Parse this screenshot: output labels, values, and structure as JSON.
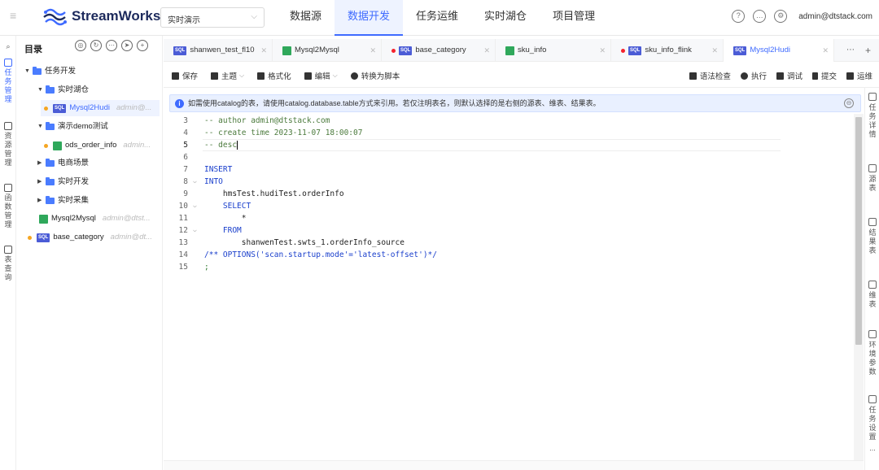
{
  "app": {
    "name": "StreamWorks",
    "project": "实时演示",
    "user": "admin@dtstack.com"
  },
  "nav": [
    "数据源",
    "数据开发",
    "任务运维",
    "实时湖仓",
    "项目管理"
  ],
  "nav_active": "数据开发",
  "left_rail": [
    "任务管理",
    "资源管理",
    "函数管理",
    "表查询"
  ],
  "sidebar": {
    "title": "目录",
    "tree": [
      {
        "label": "任务开发"
      },
      {
        "label": "实时湖仓"
      },
      {
        "label": "Mysql2Hudi",
        "owner": "admin@..."
      },
      {
        "label": "演示demo测试"
      },
      {
        "label": "ods_order_info",
        "owner": "admin..."
      },
      {
        "label": "电商场景"
      },
      {
        "label": "实时开发"
      },
      {
        "label": "实时采集"
      },
      {
        "label": "Mysql2Mysql",
        "owner": "admin@dtst..."
      },
      {
        "label": "base_category",
        "owner": "admin@dt..."
      }
    ]
  },
  "tabs": [
    {
      "label": "shanwen_test_fl10"
    },
    {
      "label": "Mysql2Mysql"
    },
    {
      "label": "base_category"
    },
    {
      "label": "sku_info"
    },
    {
      "label": "sku_info_flink"
    },
    {
      "label": "Mysql2Hudi"
    }
  ],
  "toolbar": {
    "save": "保存",
    "theme": "主题",
    "format": "格式化",
    "edit": "编辑",
    "to_script": "转换为脚本",
    "syntax_check": "语法检查",
    "run": "执行",
    "debug": "调试",
    "submit": "提交",
    "ops": "运维"
  },
  "info_text": "如需使用catalog的表，请使用catalog.database.table方式来引用。若仅注明表名，则默认选择的是右侧的源表、维表、结果表。",
  "code": {
    "lines": [
      {
        "n": "3",
        "text": "-- author admin@dtstack.com"
      },
      {
        "n": "4",
        "text": "-- create time 2023-11-07 18:00:07"
      },
      {
        "n": "5",
        "text": "-- desc"
      },
      {
        "n": "6",
        "text": ""
      },
      {
        "n": "7",
        "text": "INSERT"
      },
      {
        "n": "8",
        "text": "INTO"
      },
      {
        "n": "9",
        "text": "    hmsTest.hudiTest.orderInfo"
      },
      {
        "n": "10",
        "text": "    SELECT"
      },
      {
        "n": "11",
        "text": "        *"
      },
      {
        "n": "12",
        "text": "    FROM"
      },
      {
        "n": "13",
        "text": "        shanwenTest.swts_1.orderInfo_source"
      },
      {
        "n": "14",
        "text": "/** OPTIONS('scan.startup.mode'='latest-offset')*/"
      },
      {
        "n": "15",
        "text": ";"
      }
    ]
  },
  "right_rail": [
    "任务详情",
    "源表",
    "结果表",
    "维表",
    "环境参数",
    "任务设置"
  ],
  "right_more": "...",
  "colors": {
    "accent": "#3f6bff",
    "sql_badge": "#4b5cd6",
    "flow_badge": "#2fa85b",
    "dirty_dot": "#f5222d"
  }
}
